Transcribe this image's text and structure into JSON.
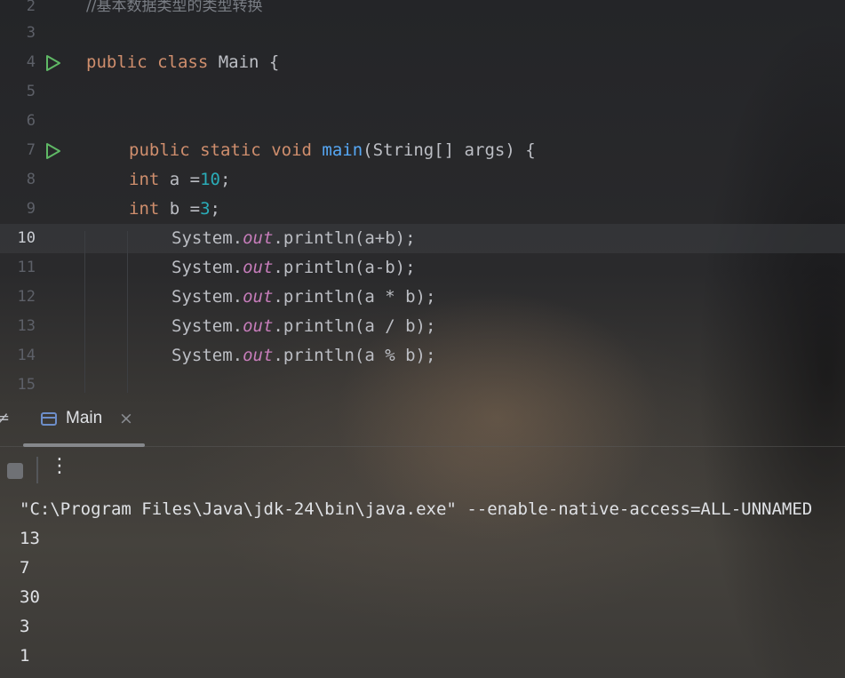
{
  "editor": {
    "lines": [
      {
        "n": "2",
        "text": "//基本数据类型的类型转换"
      },
      {
        "n": "3",
        "text": ""
      },
      {
        "n": "4",
        "text": "public class Main {"
      },
      {
        "n": "5",
        "text": ""
      },
      {
        "n": "6",
        "text": ""
      },
      {
        "n": "7",
        "text": "    public static void main(String[] args) {"
      },
      {
        "n": "8",
        "text": "    int a =10;"
      },
      {
        "n": "9",
        "text": "    int b =3;"
      },
      {
        "n": "10",
        "text": "        System.out.println(a+b);"
      },
      {
        "n": "11",
        "text": "        System.out.println(a-b);"
      },
      {
        "n": "12",
        "text": "        System.out.println(a * b);"
      },
      {
        "n": "13",
        "text": "        System.out.println(a / b);"
      },
      {
        "n": "14",
        "text": "        System.out.println(a % b);"
      },
      {
        "n": "15",
        "text": ""
      }
    ],
    "current_line": "10",
    "tokens": {
      "comment": "//基本数据类型的类型转换",
      "public": "public",
      "class": "class",
      "class_name": " Main {",
      "static": "static",
      "void": "void",
      "main": "main",
      "main_args": "(String[] args) {",
      "int": "int",
      "a_decl": " a =",
      "b_decl": " b =",
      "ten": "10",
      "three": "3",
      "semicolon": ";",
      "system": "System.",
      "out": "out",
      "println": ".println",
      "args_sum": "(a+b);",
      "args_diff": "(a-b);",
      "args_mul": "(a * b);",
      "args_div": "(a / b);",
      "args_mod": "(a % b);"
    }
  },
  "run_panel": {
    "tab_label": "Main",
    "tab_close": "×",
    "more_icon": "⋮",
    "edge_glyph": "≠"
  },
  "console": {
    "command": "\"C:\\Program Files\\Java\\jdk-24\\bin\\java.exe\" --enable-native-access=ALL-UNNAMED",
    "output": [
      "13",
      "7",
      "30",
      "3",
      "1"
    ]
  },
  "colors": {
    "keyword": "#cf8e6d",
    "function": "#56a8f5",
    "number": "#2aacb8",
    "field": "#c77dbb",
    "comment": "#7a7e85",
    "run_icon": "#5fb865"
  }
}
